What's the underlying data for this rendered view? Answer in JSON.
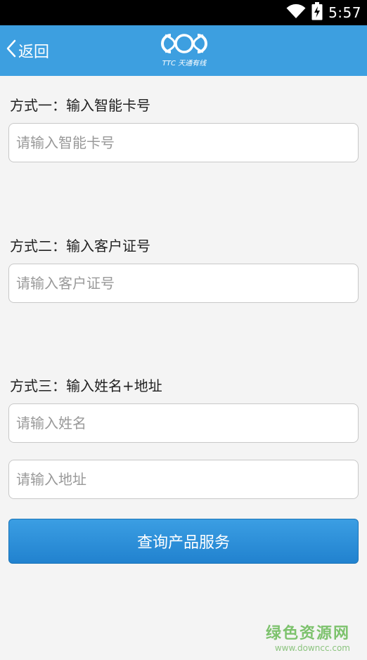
{
  "status_bar": {
    "time": "5:57"
  },
  "app_bar": {
    "back_label": "返回",
    "logo_text": "TTC 天通有线"
  },
  "method1": {
    "label": "方式一：输入智能卡号",
    "input_placeholder": "请输入智能卡号",
    "input_value": ""
  },
  "method2": {
    "label": "方式二：输入客户证号",
    "input_placeholder": "请输入客户证号",
    "input_value": ""
  },
  "method3": {
    "label": "方式三：输入姓名+地址",
    "name_placeholder": "请输入姓名",
    "name_value": "",
    "address_placeholder": "请输入地址",
    "address_value": ""
  },
  "submit": {
    "label": "查询产品服务"
  },
  "watermark": {
    "title": "绿色资源网",
    "url": "www.downcc.com"
  },
  "colors": {
    "app_bar": "#3d9fe0",
    "button": "#2182cf",
    "background": "#f4f4f4"
  }
}
